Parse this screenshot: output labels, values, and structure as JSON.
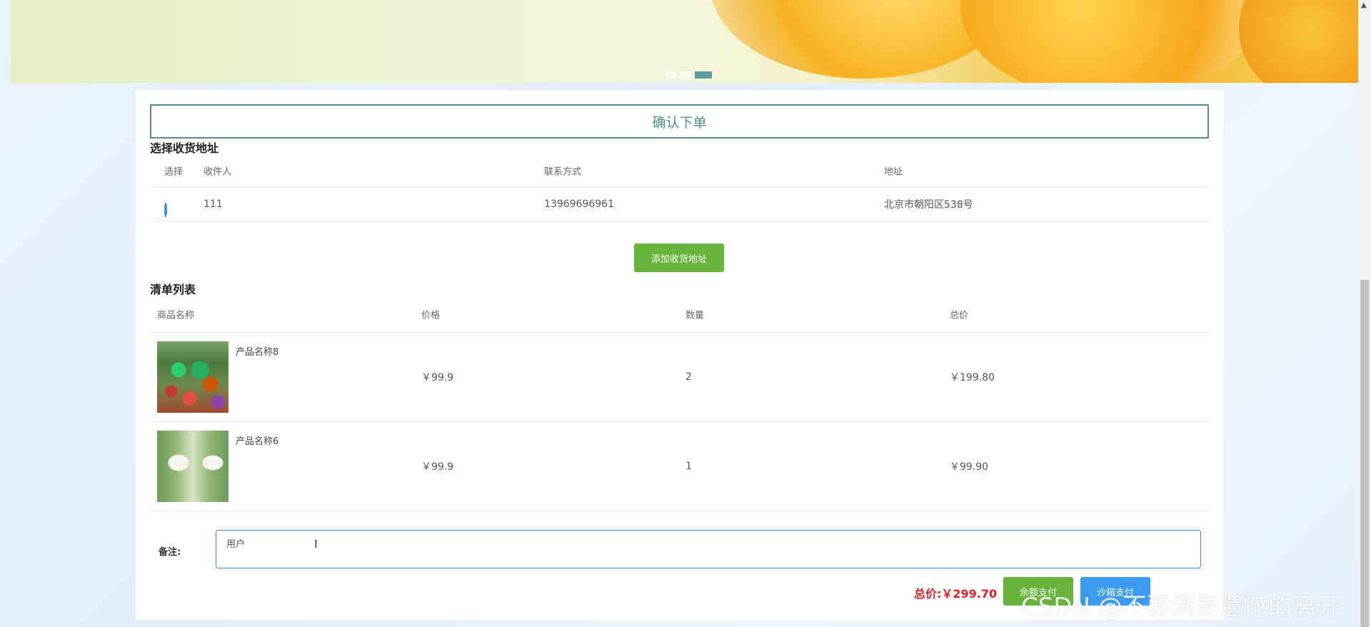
{
  "banner": {
    "dots": 3,
    "active_dot": 3
  },
  "page": {
    "title": "确认下单"
  },
  "address_section": {
    "title": "选择收货地址",
    "columns": [
      "选择",
      "收件人",
      "联系方式",
      "地址"
    ],
    "rows": [
      {
        "selected": true,
        "name": "111",
        "phone": "13969696961",
        "address": "北京市朝阳区538号"
      }
    ],
    "add_button": "添加收货地址"
  },
  "list_section": {
    "title": "清单列表",
    "columns": [
      "商品名称",
      "价格",
      "数量",
      "总价"
    ],
    "rows": [
      {
        "name": "产品名称8",
        "price": "￥99.9",
        "qty": "2",
        "total": "￥199.80",
        "image": "vegetables-image"
      },
      {
        "name": "产品名称6",
        "price": "￥99.9",
        "qty": "1",
        "total": "￥99.90",
        "image": "rice-bag-image"
      }
    ]
  },
  "remark": {
    "label": "备注:",
    "value": "用户"
  },
  "footer": {
    "total_label": "总价:",
    "total_value": "￥299.70",
    "balance_pay": "余额支付",
    "sandbox_pay": "沙箱支付"
  },
  "watermark": "CSDN @不要满是遗憾的离开",
  "colors": {
    "accent": "#4f8f93",
    "green": "#67b43a",
    "blue": "#3a9bf0",
    "price_red": "#e02020"
  }
}
